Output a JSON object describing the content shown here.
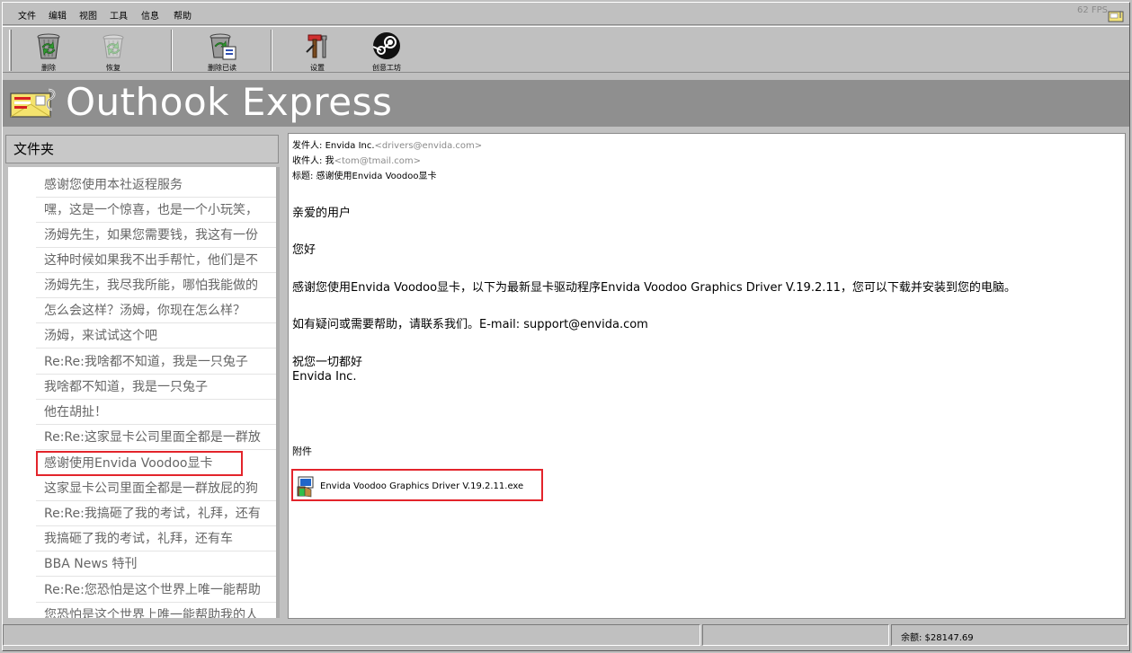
{
  "menu": {
    "items": [
      "文件",
      "编辑",
      "视图",
      "工具",
      "信息",
      "帮助"
    ]
  },
  "fps_counter": "62 FPS",
  "toolbar": {
    "delete_label": "删除",
    "restore_label": "恢复",
    "delete_read_label": "删除已读",
    "settings_label": "设置",
    "workshop_label": "创意工坊"
  },
  "banner": {
    "title": "Outhook Express"
  },
  "folders": {
    "header": "文件夹",
    "items": [
      "感谢您使用本社返程服务",
      "嘿，这是一个惊喜，也是一个小玩笑，",
      "汤姆先生，如果您需要钱，我这有一份",
      "这种时候如果我不出手帮忙，他们是不",
      "汤姆先生，我尽我所能，哪怕我能做的",
      "怎么会这样？汤姆，你现在怎么样？",
      "汤姆，来试试这个吧",
      "Re:Re:我啥都不知道，我是一只兔子",
      "我啥都不知道，我是一只兔子",
      "他在胡扯！",
      "Re:Re:这家显卡公司里面全都是一群放",
      "感谢使用Envida Voodoo显卡",
      "这家显卡公司里面全都是一群放屁的狗",
      "Re:Re:我搞砸了我的考试，礼拜，还有",
      "我搞砸了我的考试，礼拜，还有车",
      "BBA News 特刊",
      "Re:Re:您恐怕是这个世界上唯一能帮助",
      "您恐怕是这个世界上唯一能帮助我的人"
    ],
    "selected_index": 11
  },
  "message": {
    "from_label": "发件人: ",
    "from_name": "Envida Inc.",
    "from_email": "<drivers@envida.com>",
    "to_label": "收件人: ",
    "to_name": "我",
    "to_email": "<tom@tmail.com>",
    "subject_label": "标题: ",
    "subject": "感谢使用Envida Voodoo显卡",
    "body": [
      "亲爱的用户",
      "您好",
      "感谢您使用Envida Voodoo显卡，以下为最新显卡驱动程序Envida Voodoo Graphics Driver V.19.2.11，您可以下载并安装到您的电脑。",
      "如有疑问或需要帮助，请联系我们。E-mail: support@envida.com",
      "祝您一切都好",
      "Envida Inc."
    ],
    "attachments_label": "附件",
    "attachment_name": "Envida Voodoo Graphics Driver V.19.2.11.exe"
  },
  "status": {
    "balance": "余额: $28147.69"
  },
  "colors": {
    "background": "#c0c0c0",
    "banner": "#8f8f8f",
    "highlight_border": "#e3242b",
    "muted_text": "#666666"
  }
}
